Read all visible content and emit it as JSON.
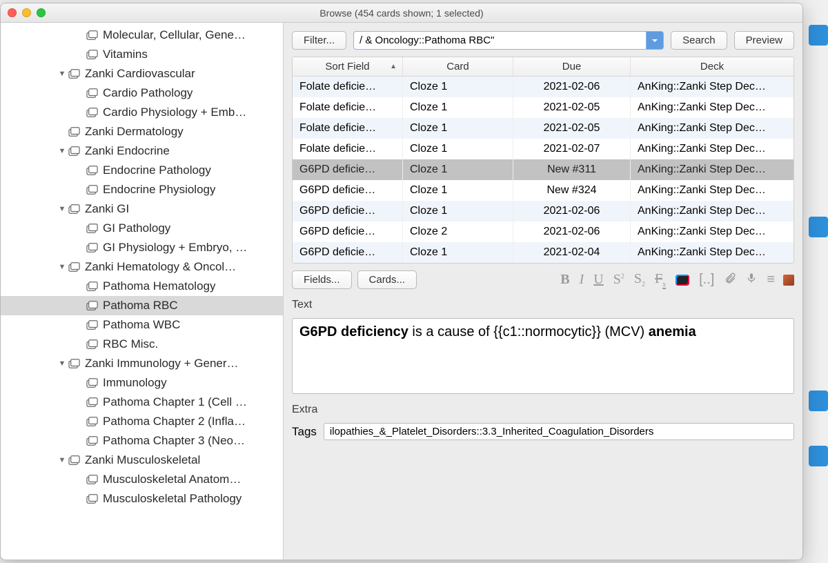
{
  "window": {
    "title": "Browse (454 cards shown; 1 selected)"
  },
  "sidebar": {
    "items": [
      {
        "indent": 3,
        "label": "Molecular, Cellular, Gene…",
        "expand": ""
      },
      {
        "indent": 3,
        "label": "Vitamins",
        "expand": ""
      },
      {
        "indent": 2,
        "label": "Zanki Cardiovascular",
        "expand": "▼"
      },
      {
        "indent": 3,
        "label": "Cardio Pathology",
        "expand": ""
      },
      {
        "indent": 3,
        "label": "Cardio Physiology + Emb…",
        "expand": ""
      },
      {
        "indent": 2,
        "label": "Zanki Dermatology",
        "expand": ""
      },
      {
        "indent": 2,
        "label": "Zanki Endocrine",
        "expand": "▼"
      },
      {
        "indent": 3,
        "label": "Endocrine Pathology",
        "expand": ""
      },
      {
        "indent": 3,
        "label": "Endocrine Physiology",
        "expand": ""
      },
      {
        "indent": 2,
        "label": "Zanki GI",
        "expand": "▼"
      },
      {
        "indent": 3,
        "label": "GI Pathology",
        "expand": ""
      },
      {
        "indent": 3,
        "label": "GI Physiology + Embryo, …",
        "expand": ""
      },
      {
        "indent": 2,
        "label": "Zanki Hematology & Oncol…",
        "expand": "▼"
      },
      {
        "indent": 3,
        "label": "Pathoma Hematology",
        "expand": ""
      },
      {
        "indent": 3,
        "label": "Pathoma RBC",
        "expand": "",
        "selected": true
      },
      {
        "indent": 3,
        "label": "Pathoma WBC",
        "expand": ""
      },
      {
        "indent": 3,
        "label": "RBC Misc.",
        "expand": ""
      },
      {
        "indent": 2,
        "label": "Zanki Immunology + Gener…",
        "expand": "▼"
      },
      {
        "indent": 3,
        "label": "Immunology",
        "expand": ""
      },
      {
        "indent": 3,
        "label": "Pathoma Chapter 1 (Cell …",
        "expand": ""
      },
      {
        "indent": 3,
        "label": "Pathoma Chapter 2 (Infla…",
        "expand": ""
      },
      {
        "indent": 3,
        "label": "Pathoma Chapter 3 (Neo…",
        "expand": ""
      },
      {
        "indent": 2,
        "label": "Zanki Musculoskeletal",
        "expand": "▼"
      },
      {
        "indent": 3,
        "label": "Musculoskeletal Anatom…",
        "expand": ""
      },
      {
        "indent": 3,
        "label": "Musculoskeletal Pathology",
        "expand": ""
      }
    ]
  },
  "toolbar": {
    "filter": "Filter...",
    "search_value": "/ & Oncology::Pathoma RBC\"",
    "search": "Search",
    "preview": "Preview"
  },
  "table": {
    "headers": {
      "sort": "Sort Field",
      "card": "Card",
      "due": "Due",
      "deck": "Deck"
    },
    "rows": [
      {
        "sort": "Folate deficie…",
        "card": "Cloze 1",
        "due": "2021-02-06",
        "deck": "AnKing::Zanki Step Dec…",
        "alt": true
      },
      {
        "sort": "Folate deficie…",
        "card": "Cloze 1",
        "due": "2021-02-05",
        "deck": "AnKing::Zanki Step Dec…"
      },
      {
        "sort": "Folate deficie…",
        "card": "Cloze 1",
        "due": "2021-02-05",
        "deck": "AnKing::Zanki Step Dec…",
        "alt": true
      },
      {
        "sort": "Folate deficie…",
        "card": "Cloze 1",
        "due": "2021-02-07",
        "deck": "AnKing::Zanki Step Dec…"
      },
      {
        "sort": "G6PD deficie…",
        "card": "Cloze 1",
        "due": "New #311",
        "deck": "AnKing::Zanki Step Dec…",
        "sel": true
      },
      {
        "sort": "G6PD deficie…",
        "card": "Cloze 1",
        "due": "New #324",
        "deck": "AnKing::Zanki Step Dec…"
      },
      {
        "sort": "G6PD deficie…",
        "card": "Cloze 1",
        "due": "2021-02-06",
        "deck": "AnKing::Zanki Step Dec…",
        "alt": true
      },
      {
        "sort": "G6PD deficie…",
        "card": "Cloze 2",
        "due": "2021-02-06",
        "deck": "AnKing::Zanki Step Dec…"
      },
      {
        "sort": "G6PD deficie…",
        "card": "Cloze 1",
        "due": "2021-02-04",
        "deck": "AnKing::Zanki Step Dec…",
        "alt": true
      }
    ]
  },
  "editor": {
    "fields_btn": "Fields...",
    "cards_btn": "Cards...",
    "text_label": "Text",
    "text_html": "<b>G6PD deficiency</b> is a cause of {{c1::normocytic}} (MCV) <b>anemia</b>",
    "extra_label": "Extra",
    "tags_label": "Tags",
    "tags_value": "ilopathies_&_Platelet_Disorders::3.3_Inherited_Coagulation_Disorders"
  }
}
